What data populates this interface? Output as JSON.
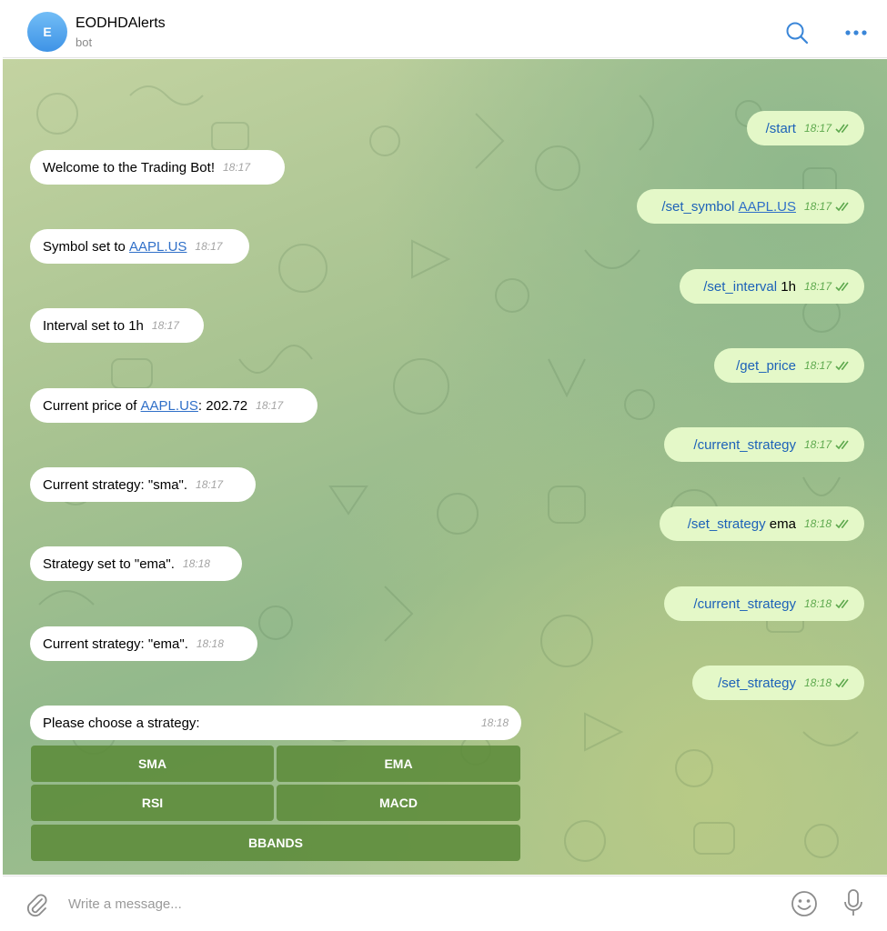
{
  "header": {
    "avatar_letter": "E",
    "title": "EODHDAlerts",
    "subtitle": "bot"
  },
  "outgoing": [
    {
      "command": "/start",
      "time": "18:17"
    },
    {
      "command": "/set_symbol",
      "link": "AAPL.US",
      "time": "18:17"
    },
    {
      "command": "/set_interval",
      "arg": "1h",
      "time": "18:17"
    },
    {
      "command": "/get_price",
      "time": "18:17"
    },
    {
      "command": "/current_strategy",
      "time": "18:17"
    },
    {
      "command": "/set_strategy",
      "arg": "ema",
      "time": "18:18"
    },
    {
      "command": "/current_strategy",
      "time": "18:18"
    },
    {
      "command": "/set_strategy",
      "time": "18:18"
    }
  ],
  "incoming": [
    {
      "text": "Welcome to the Trading Bot!",
      "time": "18:17"
    },
    {
      "text": "Symbol set to ",
      "link": "AAPL.US",
      "time": "18:17"
    },
    {
      "text": "Interval set to 1h",
      "time": "18:17"
    },
    {
      "text": "Current price of ",
      "link": "AAPL.US",
      "text_after": ": 202.72",
      "time": "18:17"
    },
    {
      "text": "Current strategy: \"sma\".",
      "time": "18:17"
    },
    {
      "text": "Strategy set to \"ema\".",
      "time": "18:18"
    },
    {
      "text": "Current strategy: \"ema\".",
      "time": "18:18"
    },
    {
      "text": "Please choose a strategy:",
      "time": "18:18"
    }
  ],
  "keyboard": {
    "buttons": [
      "SMA",
      "EMA",
      "RSI",
      "MACD",
      "BBANDS"
    ]
  },
  "composer": {
    "placeholder": "Write a message..."
  },
  "icons": {
    "search": "search-icon",
    "more": "more-dots-icon",
    "attach": "paperclip-icon",
    "emoji": "smiley-icon",
    "mic": "microphone-icon",
    "read_ticks": "double-check-icon"
  },
  "colors": {
    "accent": "#3e93e6",
    "outgoing_bubble": "#e4f8c8",
    "command_link": "#1d62b8",
    "keyboard_button": "#5c8b3a"
  }
}
